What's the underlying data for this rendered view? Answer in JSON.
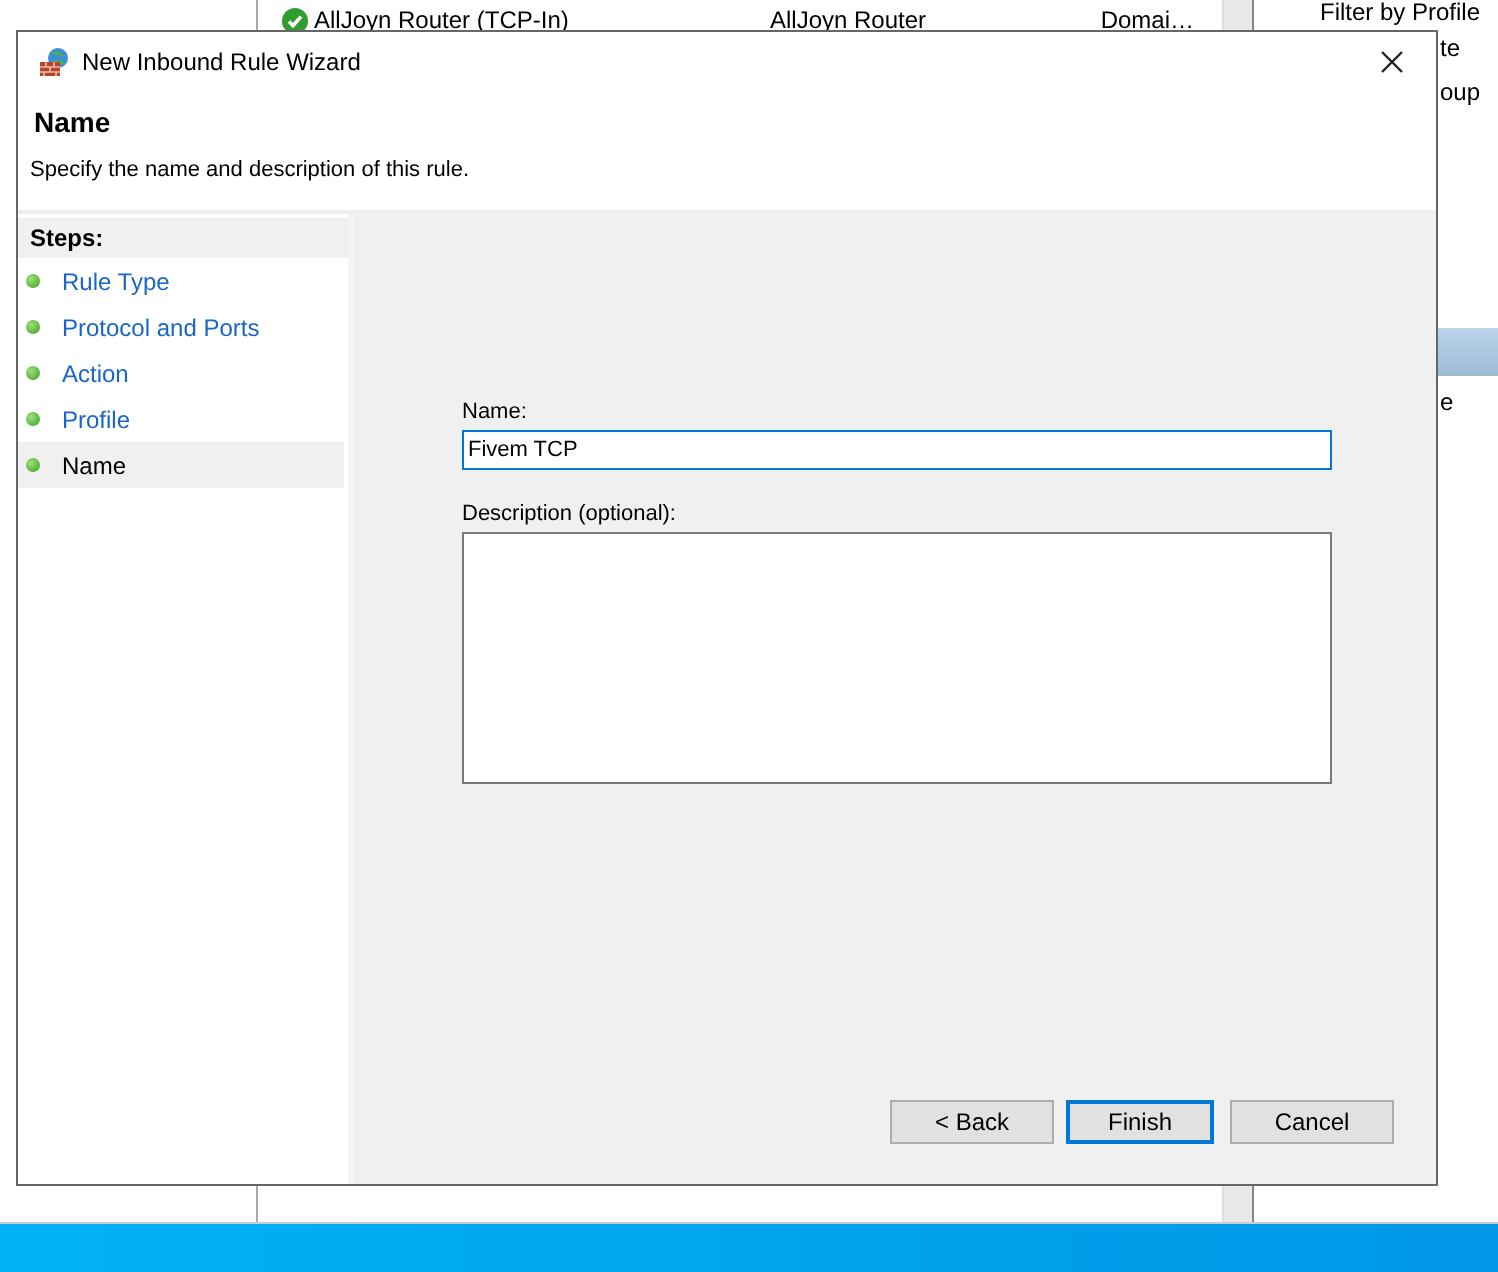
{
  "background_window": {
    "rule_row": {
      "name": "AllJoyn Router (TCP-In)",
      "group": "AllJoyn Router",
      "profile": "Domai…"
    },
    "actions_pane": {
      "top_item": "Filter by Profile",
      "items": [
        "te",
        "oup",
        "e"
      ]
    }
  },
  "dialog": {
    "title": "New Inbound Rule Wizard",
    "heading": "Name",
    "description": "Specify the name and description of this rule.",
    "steps_title": "Steps:",
    "steps": [
      {
        "label": "Rule Type",
        "selected": false
      },
      {
        "label": "Protocol and Ports",
        "selected": false
      },
      {
        "label": "Action",
        "selected": false
      },
      {
        "label": "Profile",
        "selected": false
      },
      {
        "label": "Name",
        "selected": true
      }
    ],
    "name_label": "Name:",
    "name_value": "Fivem TCP",
    "description_label": "Description (optional):",
    "buttons": [
      {
        "label": "< Back",
        "kind": "normal"
      },
      {
        "label": "Finish",
        "kind": "default"
      },
      {
        "label": "Cancel",
        "kind": "normal"
      }
    ]
  }
}
